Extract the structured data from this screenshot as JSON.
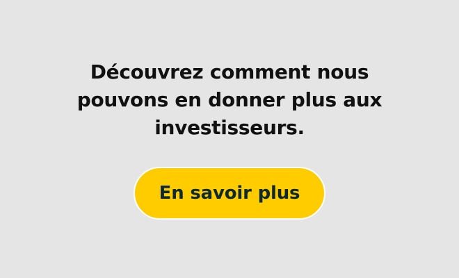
{
  "promo": {
    "headline": "Découvrez comment nous pouvons en donner plus aux investisseurs.",
    "cta_label": "En savoir plus"
  },
  "colors": {
    "background": "#e5e5e5",
    "headline_text": "#111111",
    "cta_background": "#ffcc00",
    "cta_border": "#ffffff",
    "cta_text": "#0e2a2c"
  }
}
